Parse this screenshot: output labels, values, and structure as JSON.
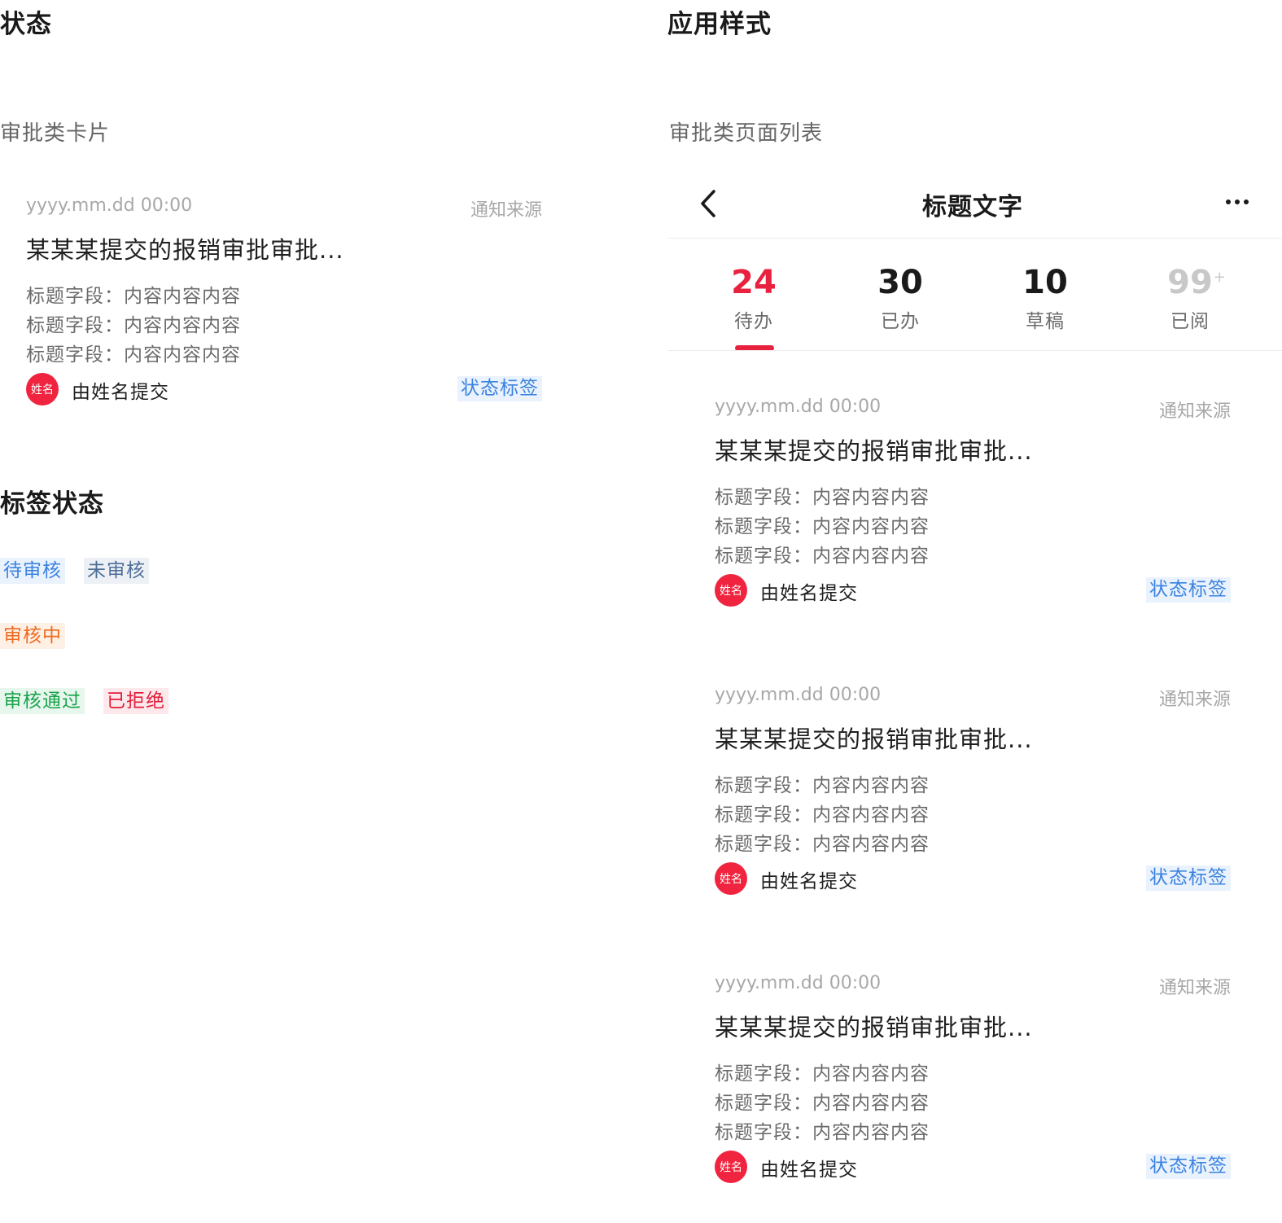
{
  "left": {
    "section_title": "状态",
    "card_subtitle": "审批类卡片",
    "tags_title": "标签状态",
    "tags": {
      "pending": "待审核",
      "unreviewed": "未审核",
      "in_review": "审核中",
      "approved": "审核通过",
      "rejected": "已拒绝"
    }
  },
  "right": {
    "section_title": "应用样式",
    "list_subtitle": "审批类页面列表",
    "nav_title": "标题文字",
    "stats": [
      {
        "value": "24",
        "label": "待办"
      },
      {
        "value": "30",
        "label": "已办"
      },
      {
        "value": "10",
        "label": "草稿"
      },
      {
        "value": "99",
        "sup": "+",
        "label": "已阅"
      }
    ]
  },
  "card": {
    "time": "yyyy.mm.dd 00:00",
    "source": "通知来源",
    "title": "某某某提交的报销审批审批...",
    "field": "标题字段：内容内容内容",
    "avatar": "姓名",
    "submitter": "由姓名提交",
    "status": "状态标签"
  },
  "colors": {
    "accent_red": "#e8213f",
    "tag_blue": "#3b83e0",
    "tag_orange": "#ee6a1f",
    "tag_green": "#19a34a"
  }
}
